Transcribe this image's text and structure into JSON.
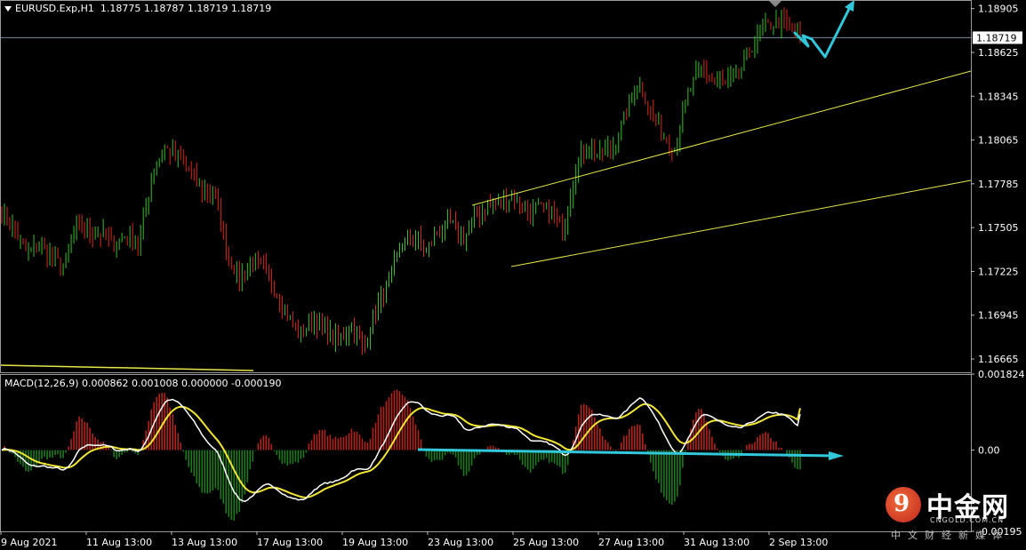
{
  "header": {
    "symbol": "EURUSD.Exp,H1",
    "ohlc": "1.18775 1.18787 1.18719 1.18719"
  },
  "macd_header": "MACD(12,26,9) 0.000862 0.001008 0.000000 -0.000190",
  "watermark": {
    "logo_char": "9",
    "name_cn": "中金网",
    "site": "CNGOLD.COM.CN",
    "tagline": "中文财经新媒体"
  },
  "colors": {
    "background": "#000000",
    "bull": "#39c12a",
    "bear": "#d92b1b",
    "channel": "#e6e64a",
    "macd_line": "#ffffff",
    "signal_line": "#f2e635",
    "hist_pos": "#b3241a",
    "hist_neg": "#1d7a1d",
    "arrow": "#32c8dc",
    "current_price_line": "#7a8aa0"
  },
  "chart_data": [
    {
      "type": "candlestick",
      "title": "EURUSD.Exp,H1",
      "current_price": 1.18719,
      "ylim": [
        1.1658,
        1.1896
      ],
      "y_ticks": [
        "1.18905",
        "1.18625",
        "1.18345",
        "1.18065",
        "1.17785",
        "1.17505",
        "1.17225",
        "1.16945",
        "1.16665"
      ],
      "x_ticks": [
        "9 Aug 2021",
        "11 Aug 13:00",
        "13 Aug 13:00",
        "17 Aug 13:00",
        "19 Aug 13:00",
        "23 Aug 13:00",
        "25 Aug 13:00",
        "27 Aug 13:00",
        "31 Aug 13:00",
        "2 Sep 13:00"
      ],
      "price_path": [
        [
          1.1765,
          1.1754
        ],
        [
          1.1752,
          1.1746
        ],
        [
          1.1738,
          1.173
        ],
        [
          1.1742,
          1.1735
        ],
        [
          1.1728,
          1.1735
        ],
        [
          1.1723,
          1.1728
        ],
        [
          1.1745,
          1.1755
        ],
        [
          1.175,
          1.1745
        ],
        [
          1.1748,
          1.1745
        ],
        [
          1.174,
          1.1738
        ],
        [
          1.1745,
          1.1748
        ],
        [
          1.1745,
          1.1735
        ],
        [
          1.177,
          1.1795
        ],
        [
          1.1805,
          1.18
        ],
        [
          1.1798,
          1.1792
        ],
        [
          1.179,
          1.1785
        ],
        [
          1.178,
          1.177
        ],
        [
          1.178,
          1.1765
        ],
        [
          1.175,
          1.1722
        ],
        [
          1.172,
          1.1715
        ],
        [
          1.1725,
          1.1732
        ],
        [
          1.172,
          1.1728
        ],
        [
          1.1718,
          1.17
        ],
        [
          1.1695,
          1.169
        ],
        [
          1.1688,
          1.1678
        ],
        [
          1.1695,
          1.169
        ],
        [
          1.1685,
          1.168
        ],
        [
          1.168,
          1.1676
        ],
        [
          1.169,
          1.1686
        ],
        [
          1.1675,
          1.167
        ],
        [
          1.1695,
          1.17
        ],
        [
          1.1705,
          1.1725
        ],
        [
          1.1735,
          1.1745
        ],
        [
          1.1748,
          1.1742
        ],
        [
          1.1742,
          1.173
        ],
        [
          1.1745,
          1.1752
        ],
        [
          1.176,
          1.1745
        ],
        [
          1.1745,
          1.174
        ],
        [
          1.1755,
          1.176
        ],
        [
          1.177,
          1.1762
        ],
        [
          1.1765,
          1.1765
        ],
        [
          1.1775,
          1.1768
        ],
        [
          1.1765,
          1.1755
        ],
        [
          1.176,
          1.1765
        ],
        [
          1.1765,
          1.1758
        ],
        [
          1.176,
          1.1737
        ],
        [
          1.1785,
          1.1795
        ],
        [
          1.1805,
          1.18
        ],
        [
          1.1795,
          1.1798
        ],
        [
          1.18,
          1.1805
        ],
        [
          1.181,
          1.1835
        ],
        [
          1.184,
          1.185
        ],
        [
          1.184,
          1.181
        ],
        [
          1.1812,
          1.1808
        ],
        [
          1.1805,
          1.1798
        ],
        [
          1.1825,
          1.1845
        ],
        [
          1.1855,
          1.185
        ],
        [
          1.1848,
          1.1842
        ],
        [
          1.1848,
          1.1838
        ],
        [
          1.1845,
          1.1852
        ],
        [
          1.1862,
          1.1868
        ],
        [
          1.1872,
          1.188
        ],
        [
          1.188,
          1.1885
        ],
        [
          1.1883,
          1.1877
        ],
        [
          1.1874,
          1.1872
        ]
      ]
    },
    {
      "type": "line",
      "title": "MACD(12,26,9)",
      "ylim": [
        -0.00195,
        0.001824
      ],
      "y_ticks": [
        "0.001824",
        "0.00",
        "-0.00195"
      ],
      "series": [
        {
          "name": "MACD",
          "values": [
            0.000862
          ]
        },
        {
          "name": "Signal",
          "values": [
            0.001008
          ]
        }
      ]
    }
  ]
}
